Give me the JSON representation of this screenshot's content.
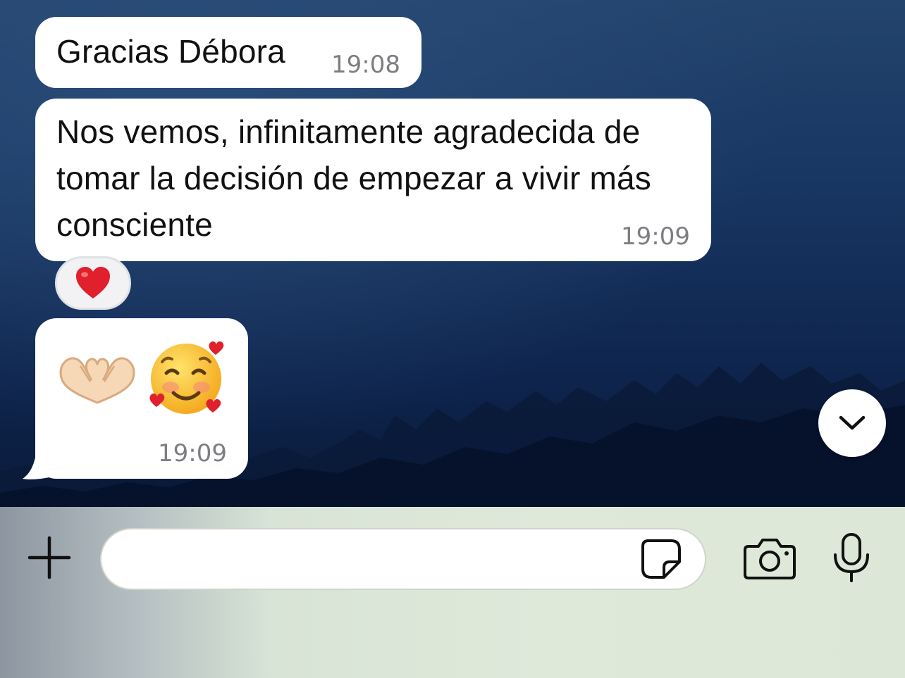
{
  "messages": [
    {
      "text": "Gracias Débora",
      "time": "19:08"
    },
    {
      "text": "Nos vemos, infinitamente agradecida de tomar la decisión de empezar a vivir más consciente",
      "time": "19:09",
      "reaction": "❤️"
    },
    {
      "emoji": "🫶🏻 🥰",
      "time": "19:09"
    }
  ],
  "composer": {
    "input_value": "",
    "input_placeholder": ""
  },
  "icons": {
    "attach": "plus-icon",
    "sticker": "sticker-icon",
    "camera": "camera-icon",
    "mic": "microphone-icon",
    "scroll": "chevron-down-icon"
  },
  "colors": {
    "bubble": "#ffffff",
    "time": "#7d7d82",
    "heart": "#e0202c"
  }
}
